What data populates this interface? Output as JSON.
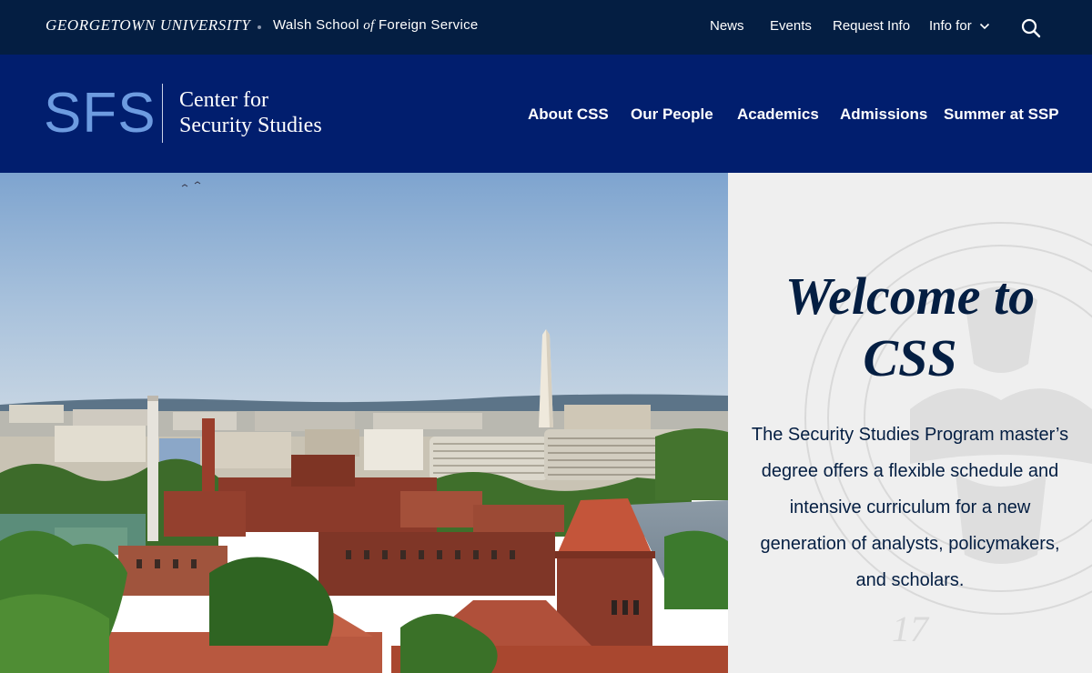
{
  "topbar": {
    "university": "GEORGETOWN UNIVERSITY",
    "school_prefix": "Walsh School",
    "school_of": "of",
    "school_suffix": "Foreign Service",
    "links": {
      "news": "News",
      "events": "Events",
      "request_info": "Request Info",
      "info_for": "Info for"
    },
    "icons": {
      "info_for": "chevron-down-icon",
      "search": "search-icon"
    }
  },
  "header": {
    "logo_text": "SFS",
    "center_line1": "Center for",
    "center_line2": "Security Studies",
    "nav": {
      "about": "About CSS",
      "people": "Our People",
      "academics": "Academics",
      "admissions": "Admissions",
      "summer": "Summer at SSP"
    }
  },
  "hero": {
    "image": "washington-dc-skyline-photo"
  },
  "welcome": {
    "title_line1": "Welcome to",
    "title_line2": "CSS",
    "body": "The Security Studies Program master’s degree offers a flexible schedule and intensive curriculum for a new generation of analysts, policymakers, and scholars.",
    "seal_number": "17"
  },
  "colors": {
    "topbar_bg": "#041e42",
    "navbar_bg": "#011e6e",
    "logo_blue": "#6d9be0",
    "text_navy": "#041e42",
    "panel_bg": "#efefef"
  }
}
